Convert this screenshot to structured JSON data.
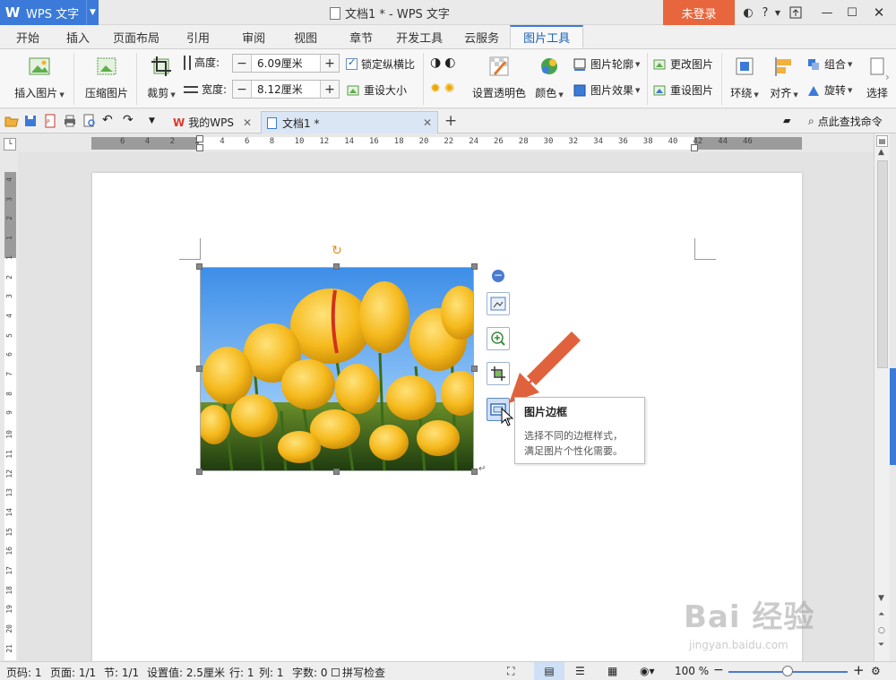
{
  "titlebar": {
    "app_name": "WPS 文字",
    "doc_title": "文档1 * - WPS 文字",
    "login_label": "未登录",
    "help_label": "?"
  },
  "ribbon_tabs": [
    {
      "label": "开始"
    },
    {
      "label": "插入"
    },
    {
      "label": "页面布局"
    },
    {
      "label": "引用"
    },
    {
      "label": "审阅"
    },
    {
      "label": "视图"
    },
    {
      "label": "章节"
    },
    {
      "label": "开发工具"
    },
    {
      "label": "云服务"
    },
    {
      "label": "图片工具",
      "active": true
    }
  ],
  "ribbon": {
    "insert_picture": "插入图片",
    "compress_picture": "压缩图片",
    "crop": "裁剪",
    "height_label": "高度:",
    "height_value": "6.09厘米",
    "width_label": "宽度:",
    "width_value": "8.12厘米",
    "lock_ratio": "锁定纵横比",
    "reset_size": "重设大小",
    "set_transparent": "设置透明色",
    "color": "颜色",
    "picture_outline": "图片轮廓",
    "picture_effect": "图片效果",
    "change_picture": "更改图片",
    "reset_picture": "重设图片",
    "wrap": "环绕",
    "align": "对齐",
    "group": "组合",
    "rotate": "旋转",
    "select": "选择"
  },
  "quickbar": {
    "my_wps_tab": "我的WPS",
    "doc_tab": "文档1 *",
    "add_tab": "+",
    "find_command": "点此查找命令"
  },
  "hruler_labels": [
    "6",
    "4",
    "2",
    "2",
    "4",
    "6",
    "8",
    "10",
    "12",
    "14",
    "16",
    "18",
    "20",
    "22",
    "24",
    "26",
    "28",
    "30",
    "32",
    "34",
    "36",
    "38",
    "40",
    "42",
    "44",
    "46"
  ],
  "vruler_labels": [
    "4",
    "3",
    "2",
    "1",
    "1",
    "2",
    "3",
    "4",
    "5",
    "6",
    "7",
    "8",
    "9",
    "10",
    "11",
    "12",
    "13",
    "14",
    "15",
    "16",
    "17",
    "18",
    "19",
    "20",
    "21"
  ],
  "tooltip": {
    "title": "图片边框",
    "desc_line1": "选择不同的边框样式，",
    "desc_line2": "满足图片个性化需要。"
  },
  "statusbar": {
    "page_num": "页码: 1",
    "pages": "页面: 1/1",
    "section": "节: 1/1",
    "setting": "设置值: 2.5厘米",
    "row": "行: 1",
    "col": "列: 1",
    "wordcount": "字数: 0",
    "spellcheck": "拼写检查",
    "zoom": "100 %"
  },
  "watermark": {
    "main": "Bai 经验",
    "sub": "jingyan.baidu.com"
  },
  "colors": {
    "accent": "#3b7ad8",
    "login": "#e8663d",
    "arrow": "#e0623c"
  }
}
